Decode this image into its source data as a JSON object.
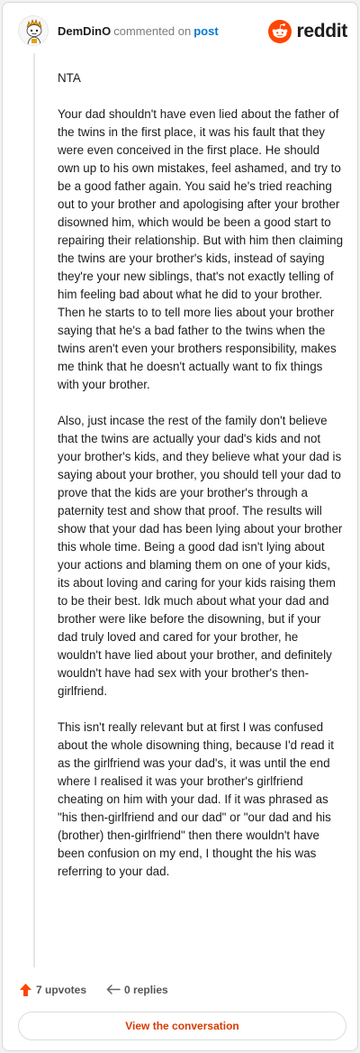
{
  "header": {
    "username": "DemDinO",
    "action_text": "commented on",
    "target_link": "post",
    "brand_name": "reddit"
  },
  "comment": {
    "paragraphs": [
      "NTA",
      "Your dad shouldn't have even lied about the father of the twins in the first place, it was his fault that they were even conceived in the first place. He should own up to his own mistakes, feel ashamed, and try to be a good father again. You said he's tried reaching out to your brother and apologising after your brother disowned him, which would be been a good start to repairing their relationship. But with him then claiming the twins are your brother's kids, instead of saying they're your new siblings, that's not exactly telling of him feeling bad about what he did to your brother. Then he starts to to tell more lies about your brother saying that he's a bad father to the twins when the twins aren't even your brothers responsibility, makes me think that he doesn't actually want to fix things with your brother.",
      "Also, just incase the rest of the family don't believe that the twins are actually your dad's kids and not your brother's kids, and they believe what your dad is saying about your brother, you should tell your dad to prove that the kids are your brother's through a paternity test and show that proof. The results will show that your dad has been lying about your brother this whole time. Being a good dad isn't lying about your actions and blaming them on one of your kids, its about loving and caring for your kids raising them to be their best. Idk much about what your dad and brother were like before the disowning, but if your dad truly loved and cared for your brother, he wouldn't have lied about your brother, and definitely wouldn't have had sex with your brother's then-girlfriend.",
      "This isn't really relevant but at first I was confused about the whole disowning thing, because I'd read it as the girlfriend was your dad's, it was until the end where I realised it was your brother's girlfriend cheating on him with your dad. If it was phrased as \"his then-girlfriend and our dad\" or \"our dad and his (brother) then-girlfriend\" then there wouldn't have been confusion on my end, I thought the his was referring to your dad."
    ]
  },
  "actions": {
    "upvotes": "7 upvotes",
    "replies": "0 replies"
  },
  "cta": {
    "label": "View the conversation"
  },
  "icons": {
    "avatar": "snoo-avatar-icon",
    "brand": "reddit-logo-icon",
    "upvote": "upvote-arrow-icon",
    "reply": "reply-arrow-icon"
  },
  "colors": {
    "brand_orange": "#ff4500",
    "link_blue": "#0079d3",
    "cta_text": "#d93a00"
  }
}
